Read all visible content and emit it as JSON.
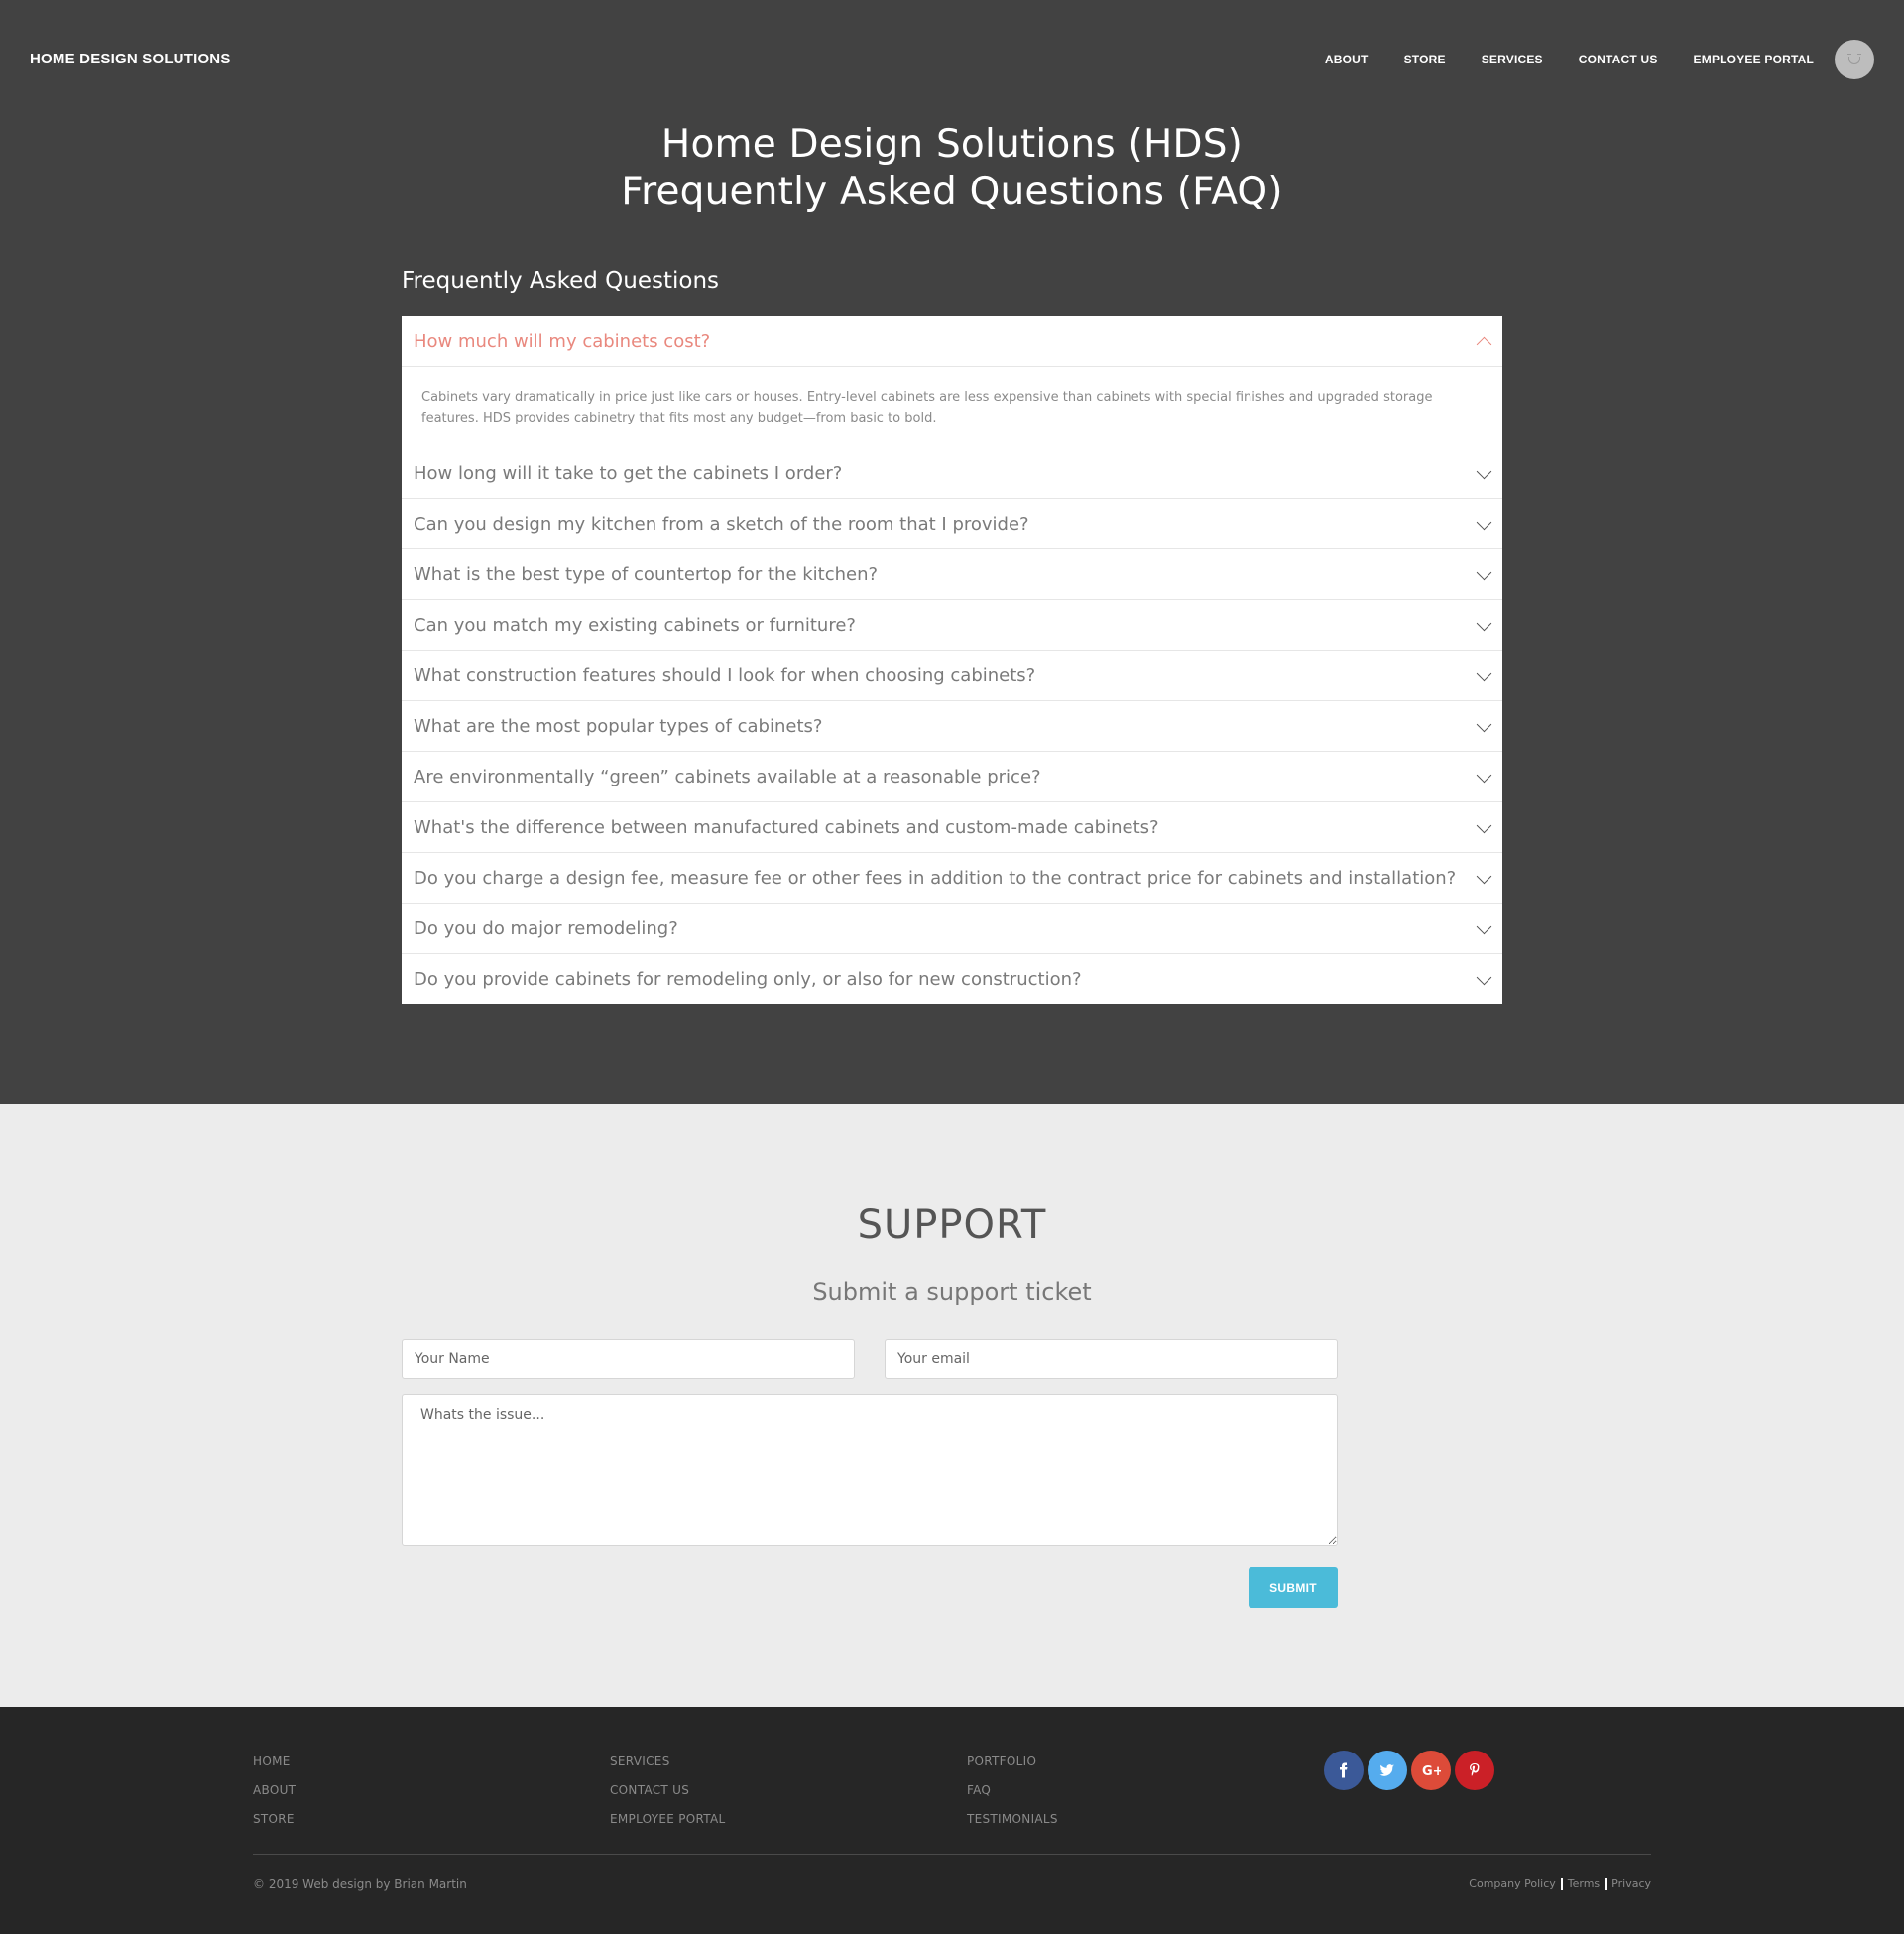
{
  "header": {
    "brand": "HOME DESIGN SOLUTIONS",
    "nav": [
      "ABOUT",
      "STORE",
      "SERVICES",
      "CONTACT US",
      "EMPLOYEE PORTAL"
    ]
  },
  "hero": {
    "title_line1": "Home Design Solutions (HDS)",
    "title_line2": "Frequently Asked Questions (FAQ)"
  },
  "faq": {
    "heading": "Frequently Asked Questions",
    "items": [
      {
        "question": "How much will my cabinets cost?",
        "answer": "Cabinets vary dramatically in price just like cars or houses. Entry-level cabinets are less expensive than cabinets with special finishes and upgraded storage features. HDS provides cabinetry that fits most any budget—from basic to bold.",
        "open": true
      },
      {
        "question": "How long will it take to get the cabinets I order?"
      },
      {
        "question": "Can you design my kitchen from a sketch of the room that I provide?"
      },
      {
        "question": "What is the best type of countertop for the kitchen?"
      },
      {
        "question": "Can you match my existing cabinets or furniture?"
      },
      {
        "question": "What construction features should I look for when choosing cabinets?"
      },
      {
        "question": "What are the most popular types of cabinets?"
      },
      {
        "question": "Are environmentally “green” cabinets available at a reasonable price?"
      },
      {
        "question": "What's the difference between manufactured cabinets and custom-made cabinets?"
      },
      {
        "question": "Do you charge a design fee, measure fee or other fees in addition to the contract price for cabinets and installation?"
      },
      {
        "question": "Do you do major remodeling?"
      },
      {
        "question": "Do you provide cabinets for remodeling only, or also for new construction?"
      }
    ]
  },
  "support": {
    "title": "SUPPORT",
    "subtitle": "Submit a support ticket",
    "name_placeholder": "Your Name",
    "email_placeholder": "Your email",
    "issue_placeholder": "Whats the issue...",
    "submit_label": "SUBMIT"
  },
  "footer": {
    "col1": [
      "HOME",
      "ABOUT",
      "STORE"
    ],
    "col2": [
      "SERVICES",
      "CONTACT US",
      "EMPLOYEE PORTAL"
    ],
    "col3": [
      "PORTFOLIO",
      "FAQ",
      "TESTIMONIALS"
    ],
    "socials": [
      {
        "icon": "facebook-icon",
        "glyph": "f",
        "color": "#3b5998"
      },
      {
        "icon": "twitter-icon",
        "glyph": "t",
        "color": "#55acee"
      },
      {
        "icon": "google-plus-icon",
        "glyph": "G+",
        "color": "#dd4b39"
      },
      {
        "icon": "pinterest-icon",
        "glyph": "p",
        "color": "#cb2027"
      }
    ],
    "copyright": "© 2019 Web design by Brian Martin",
    "legal": [
      "Company Policy",
      "Terms",
      "Privacy"
    ]
  },
  "colors": {
    "hero_bg": "#424242",
    "support_bg": "#ececec",
    "footer_bg": "#262626",
    "accent": "#4bbbd9",
    "faq_active": "#e9887e"
  }
}
